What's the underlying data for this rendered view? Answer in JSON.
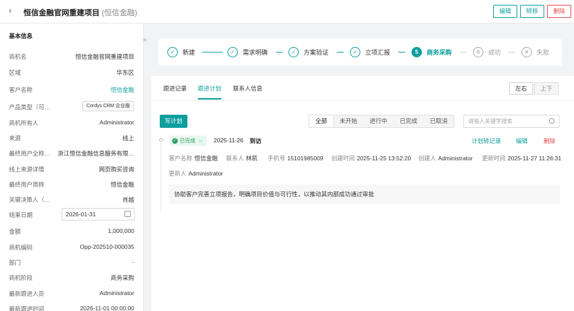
{
  "header": {
    "back_icon": "chevron-left-icon",
    "title": "恒信金融官网重建项目",
    "subtitle": "(恒信金融)",
    "actions": {
      "edit": "编辑",
      "move": "转移",
      "delete": "删除"
    }
  },
  "left": {
    "section_title": "基本信息",
    "fields": [
      {
        "k": "商机名",
        "v": "恒信金融官网重建项目"
      },
      {
        "k": "区域",
        "v": "华东区"
      },
      {
        "k": "客户名称",
        "v": "恒信金融"
      },
      {
        "k": "产品类型（可…",
        "v": "Cordys CRM 企业版"
      },
      {
        "k": "商机所有人",
        "v": "Administrator"
      },
      {
        "k": "来源",
        "v": "线上"
      },
      {
        "k": "最终用户全称…",
        "v": "浙江恒信金融信息服务有限…"
      },
      {
        "k": "线上来源详情",
        "v": "网页购买咨询"
      },
      {
        "k": "最终用户简称",
        "v": "恒信金融"
      },
      {
        "k": "关键决策人（…",
        "v": "肖越"
      },
      {
        "k": "结束日期",
        "v": "2026-01-31"
      },
      {
        "k": "金额",
        "v": "1,000,000"
      },
      {
        "k": "商机编码",
        "v": "Opp-202510-000035"
      },
      {
        "k": "部门",
        "v": "-"
      },
      {
        "k": "商机阶段",
        "v": "商务采购"
      },
      {
        "k": "最新跟进人员",
        "v": "Administrator"
      },
      {
        "k": "最新跟进时间",
        "v": "2026-11-01 00:00:00"
      }
    ]
  },
  "steps": [
    {
      "label": "新建",
      "mark": "✓"
    },
    {
      "label": "需求明确",
      "mark": "✓"
    },
    {
      "label": "方案验证",
      "mark": "✓"
    },
    {
      "label": "立项汇报",
      "mark": "✓"
    },
    {
      "label": "商务采购",
      "mark": "5"
    },
    {
      "label": "成功",
      "mark": "6"
    },
    {
      "label": "失败",
      "mark": "✕"
    }
  ],
  "tabs": [
    "跟进记录",
    "跟进计划",
    "联系人信息"
  ],
  "layout_toggle": {
    "left": "左右",
    "right": "上下"
  },
  "plan_button": "写计划",
  "filters": [
    "全部",
    "未开始",
    "进行中",
    "已完成",
    "已取消"
  ],
  "search_placeholder": "请输入关键字搜索",
  "record": {
    "status": "已完成",
    "date": "2025-11-26",
    "type": "到访",
    "actions": {
      "convert": "计划转记录",
      "edit": "编辑",
      "delete": "删除"
    },
    "meta": {
      "customer_k": "客户名称",
      "customer_v": "恒信金融",
      "contact_k": "联系人",
      "contact_v": "林凯",
      "phone_k": "手机号",
      "phone_v": "15101985009",
      "created_k": "创建时间",
      "created_v": "2025-11-25 13:52:20",
      "creator_k": "创建人",
      "creator_v": "Administrator",
      "updated_k": "更新时间",
      "updated_v": "2025-11-27 11:26:31",
      "updater_k": "更新人",
      "updater_v": "Administrator"
    },
    "content": "协助客户完善立项报告，明确项目价值与可行性，以推动其内部成功通过审批"
  }
}
